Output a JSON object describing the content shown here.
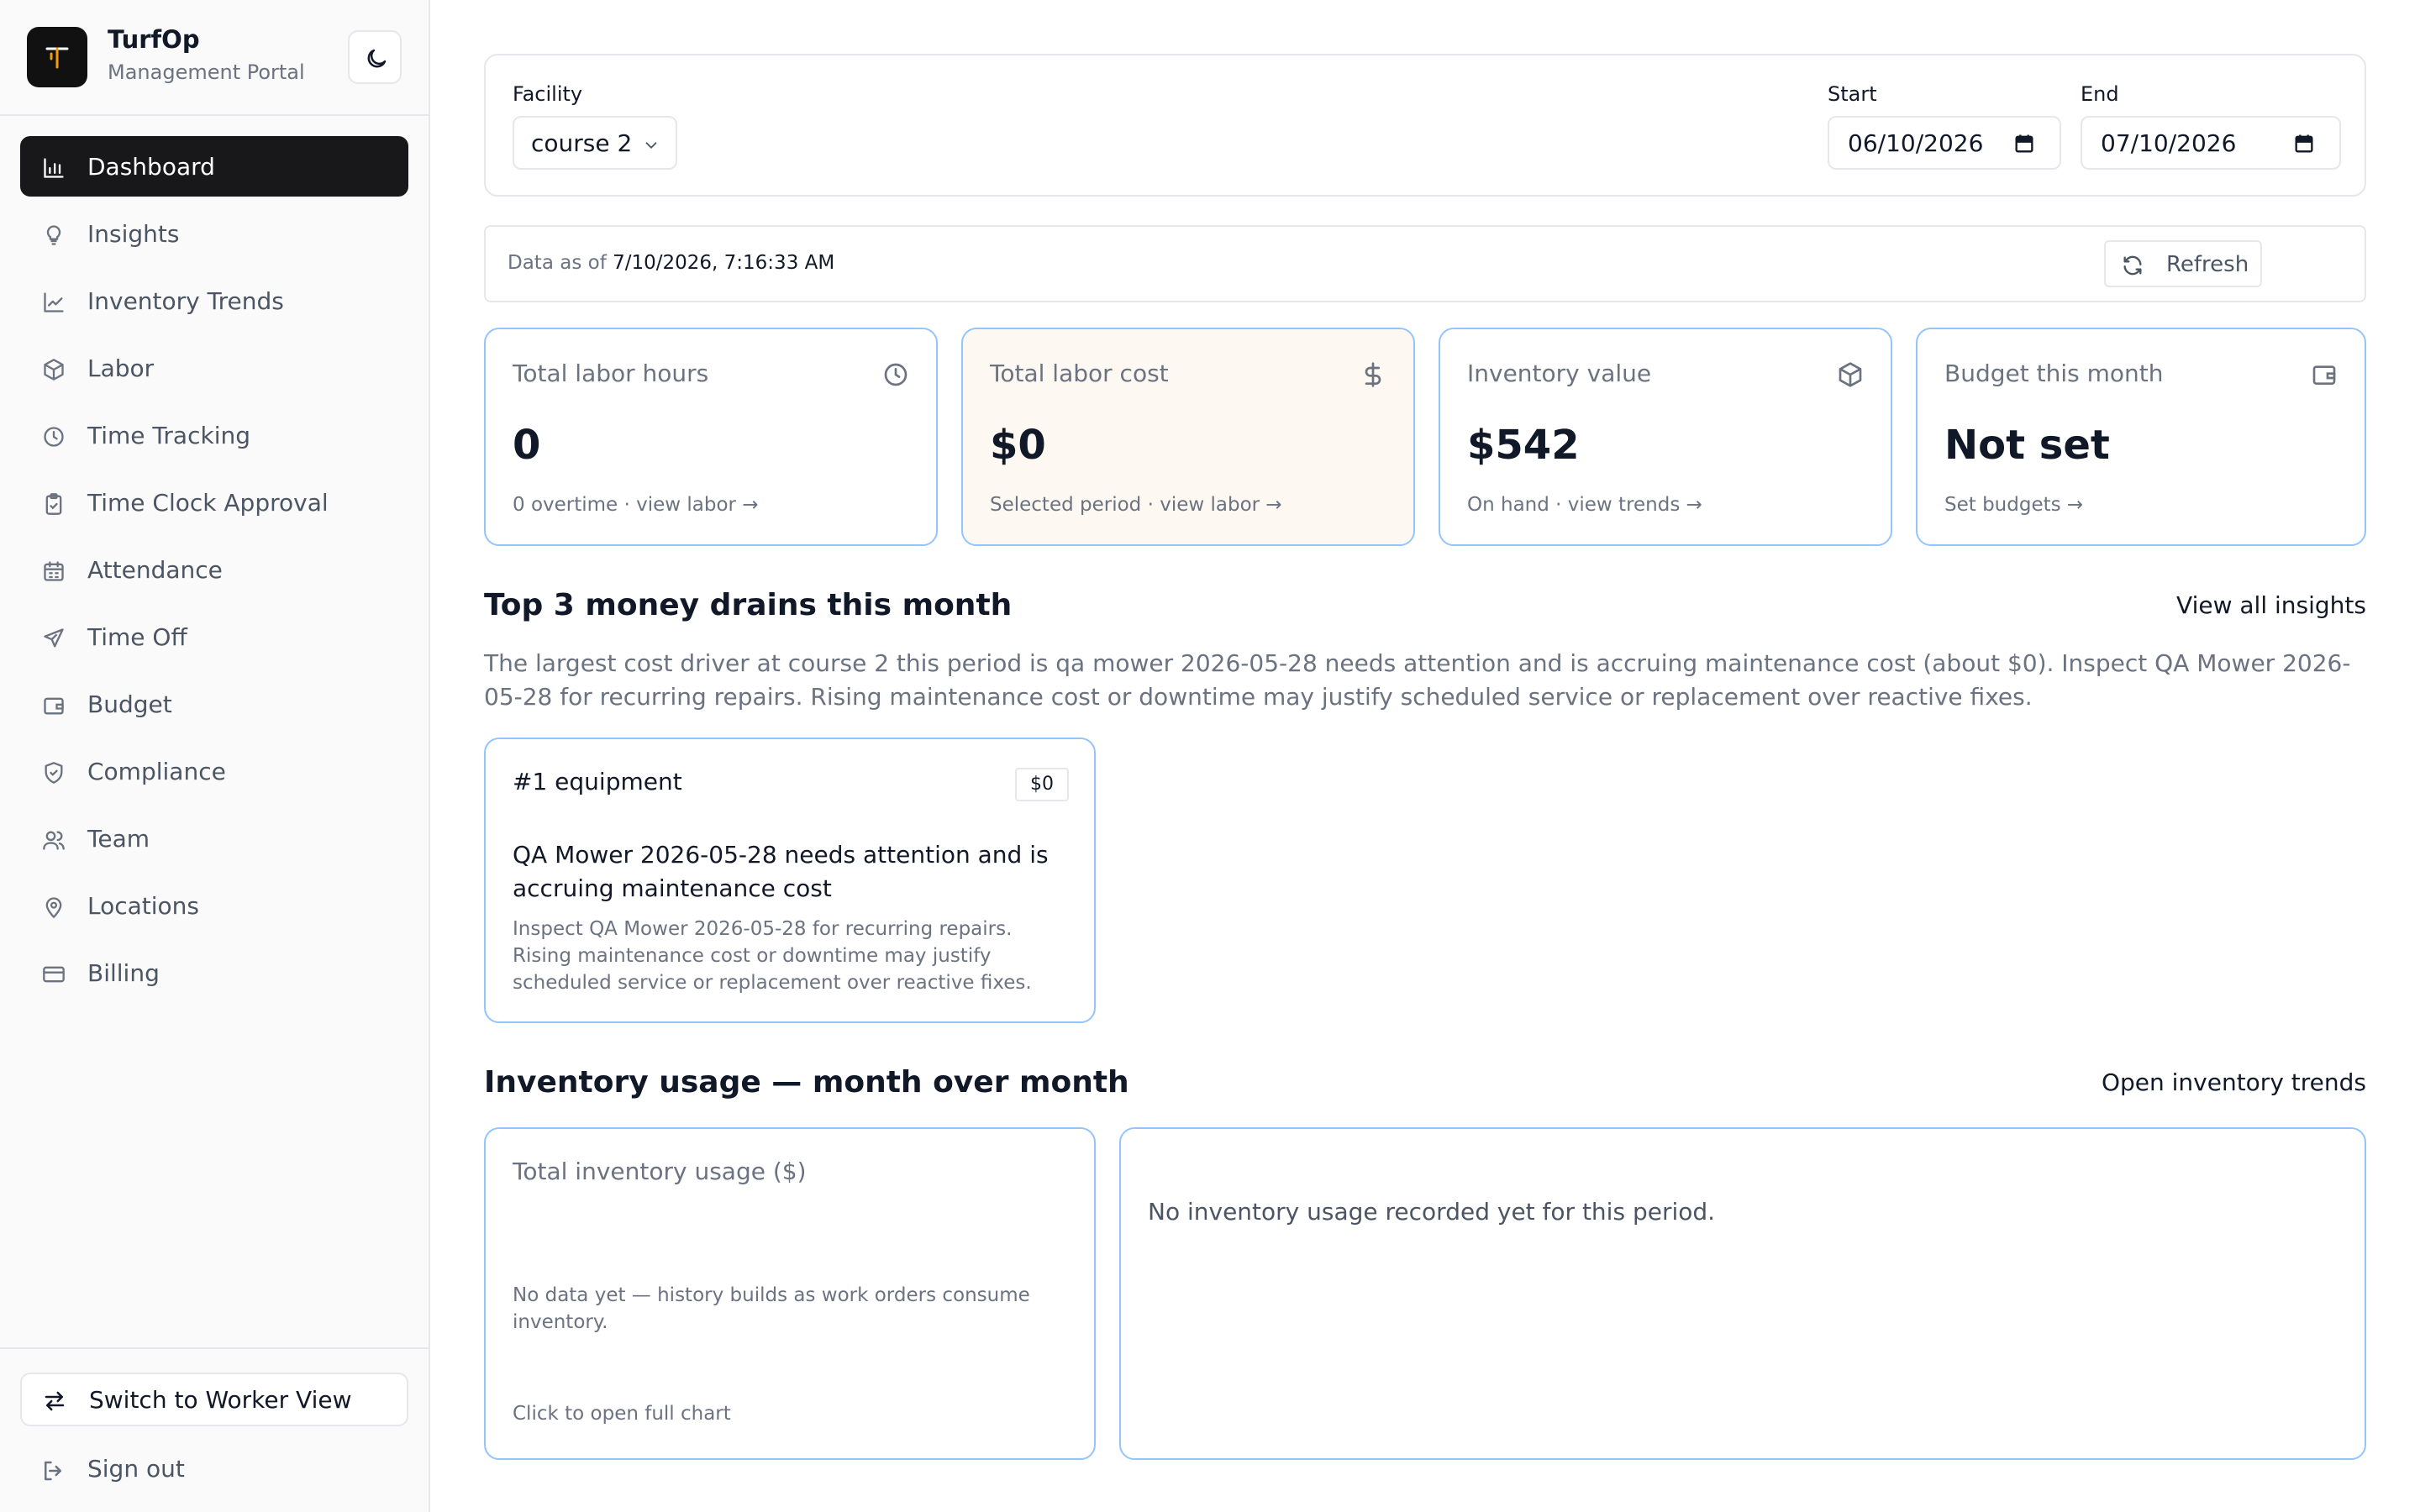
{
  "brand": {
    "name": "TurfOp",
    "subtitle": "Management Portal"
  },
  "sidebar": {
    "items": [
      {
        "label": "Dashboard",
        "icon": "bar-chart-icon",
        "active": true
      },
      {
        "label": "Insights",
        "icon": "lightbulb-icon"
      },
      {
        "label": "Inventory Trends",
        "icon": "line-chart-icon"
      },
      {
        "label": "Labor",
        "icon": "box-icon"
      },
      {
        "label": "Time Tracking",
        "icon": "clock-icon"
      },
      {
        "label": "Time Clock Approval",
        "icon": "clipboard-check-icon"
      },
      {
        "label": "Attendance",
        "icon": "calendar-icon"
      },
      {
        "label": "Time Off",
        "icon": "plane-icon"
      },
      {
        "label": "Budget",
        "icon": "wallet-icon"
      },
      {
        "label": "Compliance",
        "icon": "shield-check-icon"
      },
      {
        "label": "Team",
        "icon": "users-icon"
      },
      {
        "label": "Locations",
        "icon": "map-pin-icon"
      },
      {
        "label": "Billing",
        "icon": "credit-card-icon"
      }
    ],
    "footer": {
      "switch_label": "Switch to Worker View",
      "signout_label": "Sign out"
    }
  },
  "filters": {
    "facility_label": "Facility",
    "facility_value": "course 2",
    "start_label": "Start",
    "start_value": "06/10/2026",
    "end_label": "End",
    "end_value": "07/10/2026"
  },
  "status": {
    "prefix": "Data as of ",
    "timestamp": "7/10/2026, 7:16:33 AM",
    "refresh_label": "Refresh"
  },
  "kpis": [
    {
      "title": "Total labor hours",
      "value": "0",
      "sub": "0 overtime · view labor →",
      "icon": "clock-icon"
    },
    {
      "title": "Total labor cost",
      "value": "$0",
      "sub": "Selected period · view labor →",
      "icon": "dollar-icon"
    },
    {
      "title": "Inventory value",
      "value": "$542",
      "sub": "On hand · view trends →",
      "icon": "box-icon"
    },
    {
      "title": "Budget this month",
      "value": "Not set",
      "sub": "Set budgets →",
      "icon": "wallet-icon"
    }
  ],
  "drains": {
    "title": "Top 3 money drains this month",
    "link": "View all insights",
    "summary": "The largest cost driver at course 2 this period is qa mower 2026-05-28 needs attention and is accruing maintenance cost (about $0). Inspect QA Mower 2026-05-28 for recurring repairs. Rising maintenance cost or downtime may justify scheduled service or replacement over reactive fixes.",
    "items": [
      {
        "rank": "#1 equipment",
        "amount": "$0",
        "title": "QA Mower 2026-05-28 needs attention and is accruing maintenance cost",
        "description": "Inspect QA Mower 2026-05-28 for recurring repairs. Rising maintenance cost or downtime may justify scheduled service or replacement over reactive fixes."
      }
    ]
  },
  "inventory": {
    "title": "Inventory usage — month over month",
    "link": "Open inventory trends",
    "card_title": "Total inventory usage ($)",
    "card_empty": "No data yet — history builds as work orders consume inventory.",
    "card_footer": "Click to open full chart",
    "panel_empty": "No inventory usage recorded yet for this period."
  },
  "colors": {
    "accent_border": "#93c5fd",
    "active_nav": "#18181b",
    "warm_card": "#fdf8f1",
    "logo_mark": "#f59e0b"
  }
}
